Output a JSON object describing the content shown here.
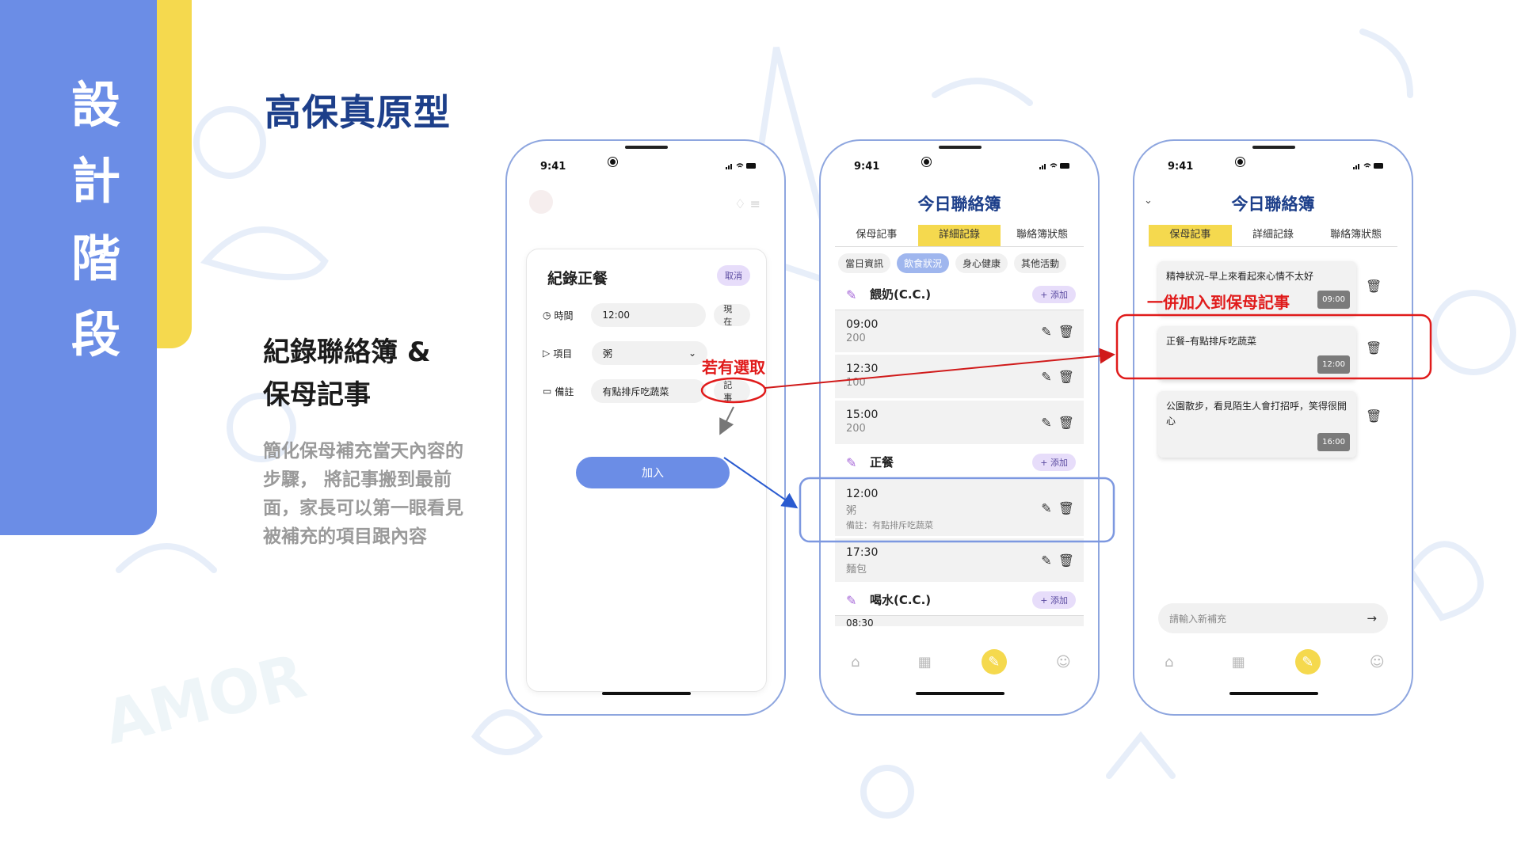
{
  "sidebar": {
    "chars": [
      "設",
      "計",
      "階",
      "段"
    ]
  },
  "page_title": "高保真原型",
  "section": {
    "title_line1": "紀錄聯絡簿 &",
    "title_line2": "保母記事",
    "desc": "簡化保母補充當天內容的步驟， 將記事搬到最前面，家長可以第一眼看見被補充的項目跟內容"
  },
  "status_time": "9:41",
  "phone1": {
    "form_title": "紀錄正餐",
    "cancel": "取消",
    "time_label": "時間",
    "time_value": "12:00",
    "now_btn": "現在",
    "item_label": "項目",
    "item_value": "粥",
    "note_label": "備註",
    "note_value": "有點排斥吃蔬菜",
    "memo_btn": "記事",
    "submit": "加入"
  },
  "phone2": {
    "title": "今日聯絡簿",
    "tabs": [
      "保母記事",
      "詳細記錄",
      "聯絡簿狀態"
    ],
    "chips": [
      "當日資訊",
      "飲食狀況",
      "身心健康",
      "其他活動"
    ],
    "add_label": "+ 添加",
    "sections": {
      "milk": {
        "name": "餵奶(C.C.)",
        "rows": [
          {
            "time": "09:00",
            "sub": "200"
          },
          {
            "time": "12:30",
            "sub": "100"
          },
          {
            "time": "15:00",
            "sub": "200"
          }
        ]
      },
      "meal": {
        "name": "正餐",
        "rows": [
          {
            "time": "12:00",
            "sub": "粥",
            "note": "備註：有點排斥吃蔬菜"
          },
          {
            "time": "17:30",
            "sub": "麵包"
          }
        ]
      },
      "water": {
        "name": "喝水(C.C.)",
        "partial_time": "08:30"
      }
    }
  },
  "phone3": {
    "title": "今日聯絡簿",
    "tabs": [
      "保母記事",
      "詳細記錄",
      "聯絡簿狀態"
    ],
    "memos": [
      {
        "text": "精神狀況–早上來看起來心情不太好",
        "time": "09:00"
      },
      {
        "text": "正餐–有點排斥吃蔬菜",
        "time": "12:00"
      },
      {
        "text": "公園散步，看見陌生人會打招呼，笑得很開心",
        "time": "16:00"
      }
    ],
    "input_placeholder": "請輸入新補充"
  },
  "annotations": {
    "if_selected": "若有選取",
    "add_to_memo": "一併加入到保母記事"
  },
  "colors": {
    "brand_blue": "#6b8de6",
    "accent_yellow": "#f5d94e",
    "title_navy": "#1d3f8a",
    "annotation_red": "#e01b1b"
  },
  "watermark": "AMOR"
}
